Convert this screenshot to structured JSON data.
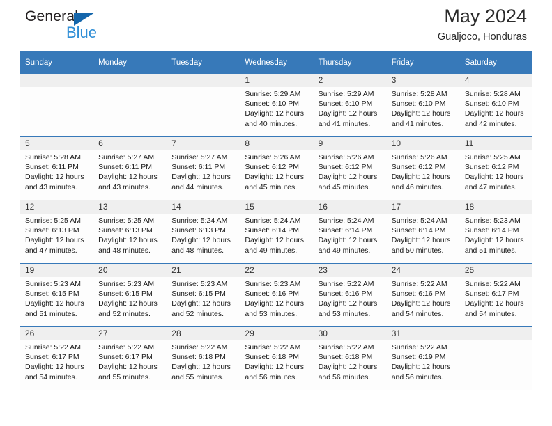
{
  "logo": {
    "text_top": "General",
    "text_bottom": "Blue",
    "triangle_color": "#1466ab",
    "blue_color": "#2f8ed6"
  },
  "header": {
    "title": "May 2024",
    "subtitle": "Gualjoco, Honduras"
  },
  "theme": {
    "header_blue": "#3779b9",
    "daynum_gray": "#efefef"
  },
  "calendar": {
    "weekday_headers": [
      "Sunday",
      "Monday",
      "Tuesday",
      "Wednesday",
      "Thursday",
      "Friday",
      "Saturday"
    ],
    "weeks": [
      [
        {
          "day": "",
          "sunrise": "",
          "sunset": "",
          "daylight_line1": "",
          "daylight_line2": ""
        },
        {
          "day": "",
          "sunrise": "",
          "sunset": "",
          "daylight_line1": "",
          "daylight_line2": ""
        },
        {
          "day": "",
          "sunrise": "",
          "sunset": "",
          "daylight_line1": "",
          "daylight_line2": ""
        },
        {
          "day": "1",
          "sunrise": "Sunrise: 5:29 AM",
          "sunset": "Sunset: 6:10 PM",
          "daylight_line1": "Daylight: 12 hours",
          "daylight_line2": "and 40 minutes."
        },
        {
          "day": "2",
          "sunrise": "Sunrise: 5:29 AM",
          "sunset": "Sunset: 6:10 PM",
          "daylight_line1": "Daylight: 12 hours",
          "daylight_line2": "and 41 minutes."
        },
        {
          "day": "3",
          "sunrise": "Sunrise: 5:28 AM",
          "sunset": "Sunset: 6:10 PM",
          "daylight_line1": "Daylight: 12 hours",
          "daylight_line2": "and 41 minutes."
        },
        {
          "day": "4",
          "sunrise": "Sunrise: 5:28 AM",
          "sunset": "Sunset: 6:10 PM",
          "daylight_line1": "Daylight: 12 hours",
          "daylight_line2": "and 42 minutes."
        }
      ],
      [
        {
          "day": "5",
          "sunrise": "Sunrise: 5:28 AM",
          "sunset": "Sunset: 6:11 PM",
          "daylight_line1": "Daylight: 12 hours",
          "daylight_line2": "and 43 minutes."
        },
        {
          "day": "6",
          "sunrise": "Sunrise: 5:27 AM",
          "sunset": "Sunset: 6:11 PM",
          "daylight_line1": "Daylight: 12 hours",
          "daylight_line2": "and 43 minutes."
        },
        {
          "day": "7",
          "sunrise": "Sunrise: 5:27 AM",
          "sunset": "Sunset: 6:11 PM",
          "daylight_line1": "Daylight: 12 hours",
          "daylight_line2": "and 44 minutes."
        },
        {
          "day": "8",
          "sunrise": "Sunrise: 5:26 AM",
          "sunset": "Sunset: 6:12 PM",
          "daylight_line1": "Daylight: 12 hours",
          "daylight_line2": "and 45 minutes."
        },
        {
          "day": "9",
          "sunrise": "Sunrise: 5:26 AM",
          "sunset": "Sunset: 6:12 PM",
          "daylight_line1": "Daylight: 12 hours",
          "daylight_line2": "and 45 minutes."
        },
        {
          "day": "10",
          "sunrise": "Sunrise: 5:26 AM",
          "sunset": "Sunset: 6:12 PM",
          "daylight_line1": "Daylight: 12 hours",
          "daylight_line2": "and 46 minutes."
        },
        {
          "day": "11",
          "sunrise": "Sunrise: 5:25 AM",
          "sunset": "Sunset: 6:12 PM",
          "daylight_line1": "Daylight: 12 hours",
          "daylight_line2": "and 47 minutes."
        }
      ],
      [
        {
          "day": "12",
          "sunrise": "Sunrise: 5:25 AM",
          "sunset": "Sunset: 6:13 PM",
          "daylight_line1": "Daylight: 12 hours",
          "daylight_line2": "and 47 minutes."
        },
        {
          "day": "13",
          "sunrise": "Sunrise: 5:25 AM",
          "sunset": "Sunset: 6:13 PM",
          "daylight_line1": "Daylight: 12 hours",
          "daylight_line2": "and 48 minutes."
        },
        {
          "day": "14",
          "sunrise": "Sunrise: 5:24 AM",
          "sunset": "Sunset: 6:13 PM",
          "daylight_line1": "Daylight: 12 hours",
          "daylight_line2": "and 48 minutes."
        },
        {
          "day": "15",
          "sunrise": "Sunrise: 5:24 AM",
          "sunset": "Sunset: 6:14 PM",
          "daylight_line1": "Daylight: 12 hours",
          "daylight_line2": "and 49 minutes."
        },
        {
          "day": "16",
          "sunrise": "Sunrise: 5:24 AM",
          "sunset": "Sunset: 6:14 PM",
          "daylight_line1": "Daylight: 12 hours",
          "daylight_line2": "and 49 minutes."
        },
        {
          "day": "17",
          "sunrise": "Sunrise: 5:24 AM",
          "sunset": "Sunset: 6:14 PM",
          "daylight_line1": "Daylight: 12 hours",
          "daylight_line2": "and 50 minutes."
        },
        {
          "day": "18",
          "sunrise": "Sunrise: 5:23 AM",
          "sunset": "Sunset: 6:14 PM",
          "daylight_line1": "Daylight: 12 hours",
          "daylight_line2": "and 51 minutes."
        }
      ],
      [
        {
          "day": "19",
          "sunrise": "Sunrise: 5:23 AM",
          "sunset": "Sunset: 6:15 PM",
          "daylight_line1": "Daylight: 12 hours",
          "daylight_line2": "and 51 minutes."
        },
        {
          "day": "20",
          "sunrise": "Sunrise: 5:23 AM",
          "sunset": "Sunset: 6:15 PM",
          "daylight_line1": "Daylight: 12 hours",
          "daylight_line2": "and 52 minutes."
        },
        {
          "day": "21",
          "sunrise": "Sunrise: 5:23 AM",
          "sunset": "Sunset: 6:15 PM",
          "daylight_line1": "Daylight: 12 hours",
          "daylight_line2": "and 52 minutes."
        },
        {
          "day": "22",
          "sunrise": "Sunrise: 5:23 AM",
          "sunset": "Sunset: 6:16 PM",
          "daylight_line1": "Daylight: 12 hours",
          "daylight_line2": "and 53 minutes."
        },
        {
          "day": "23",
          "sunrise": "Sunrise: 5:22 AM",
          "sunset": "Sunset: 6:16 PM",
          "daylight_line1": "Daylight: 12 hours",
          "daylight_line2": "and 53 minutes."
        },
        {
          "day": "24",
          "sunrise": "Sunrise: 5:22 AM",
          "sunset": "Sunset: 6:16 PM",
          "daylight_line1": "Daylight: 12 hours",
          "daylight_line2": "and 54 minutes."
        },
        {
          "day": "25",
          "sunrise": "Sunrise: 5:22 AM",
          "sunset": "Sunset: 6:17 PM",
          "daylight_line1": "Daylight: 12 hours",
          "daylight_line2": "and 54 minutes."
        }
      ],
      [
        {
          "day": "26",
          "sunrise": "Sunrise: 5:22 AM",
          "sunset": "Sunset: 6:17 PM",
          "daylight_line1": "Daylight: 12 hours",
          "daylight_line2": "and 54 minutes."
        },
        {
          "day": "27",
          "sunrise": "Sunrise: 5:22 AM",
          "sunset": "Sunset: 6:17 PM",
          "daylight_line1": "Daylight: 12 hours",
          "daylight_line2": "and 55 minutes."
        },
        {
          "day": "28",
          "sunrise": "Sunrise: 5:22 AM",
          "sunset": "Sunset: 6:18 PM",
          "daylight_line1": "Daylight: 12 hours",
          "daylight_line2": "and 55 minutes."
        },
        {
          "day": "29",
          "sunrise": "Sunrise: 5:22 AM",
          "sunset": "Sunset: 6:18 PM",
          "daylight_line1": "Daylight: 12 hours",
          "daylight_line2": "and 56 minutes."
        },
        {
          "day": "30",
          "sunrise": "Sunrise: 5:22 AM",
          "sunset": "Sunset: 6:18 PM",
          "daylight_line1": "Daylight: 12 hours",
          "daylight_line2": "and 56 minutes."
        },
        {
          "day": "31",
          "sunrise": "Sunrise: 5:22 AM",
          "sunset": "Sunset: 6:19 PM",
          "daylight_line1": "Daylight: 12 hours",
          "daylight_line2": "and 56 minutes."
        },
        {
          "day": "",
          "sunrise": "",
          "sunset": "",
          "daylight_line1": "",
          "daylight_line2": ""
        }
      ]
    ]
  }
}
